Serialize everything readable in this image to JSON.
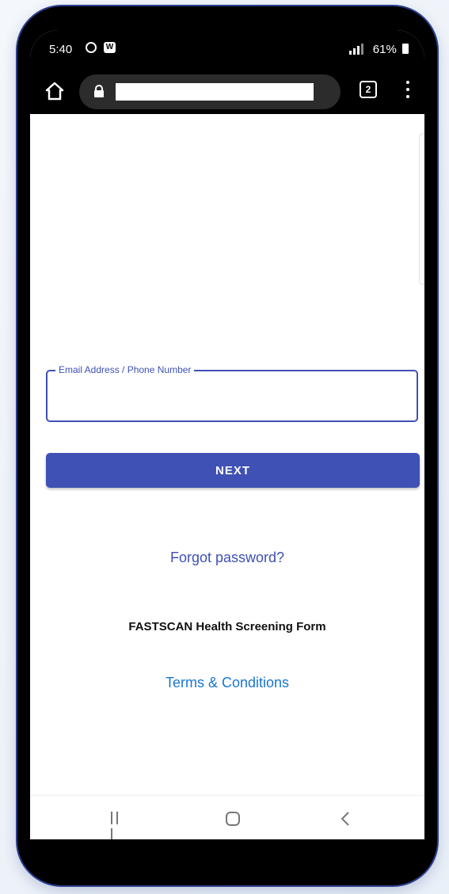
{
  "status_bar": {
    "time": "5:40",
    "right_text": "61%",
    "icons": [
      "whatsapp-icon",
      "message-icon",
      "data-icon",
      "signal-icon",
      "battery-icon"
    ]
  },
  "browser": {
    "url": "",
    "tab_count": "2",
    "icons": [
      "home-icon",
      "lock-icon",
      "tabs-icon",
      "menu-icon"
    ]
  },
  "login": {
    "field_label": "Email Address / Phone Number",
    "field_value": "",
    "next_label": "NEXT",
    "forgot_label": "Forgot password?",
    "form_title": "FASTSCAN Health Screening Form",
    "terms_label": "Terms & Conditions"
  },
  "nav": {
    "icons": [
      "recents-icon",
      "home-nav-icon",
      "back-icon"
    ]
  },
  "colors": {
    "accent": "#3f51b5",
    "link": "#1976d2",
    "frame": "#000000"
  }
}
